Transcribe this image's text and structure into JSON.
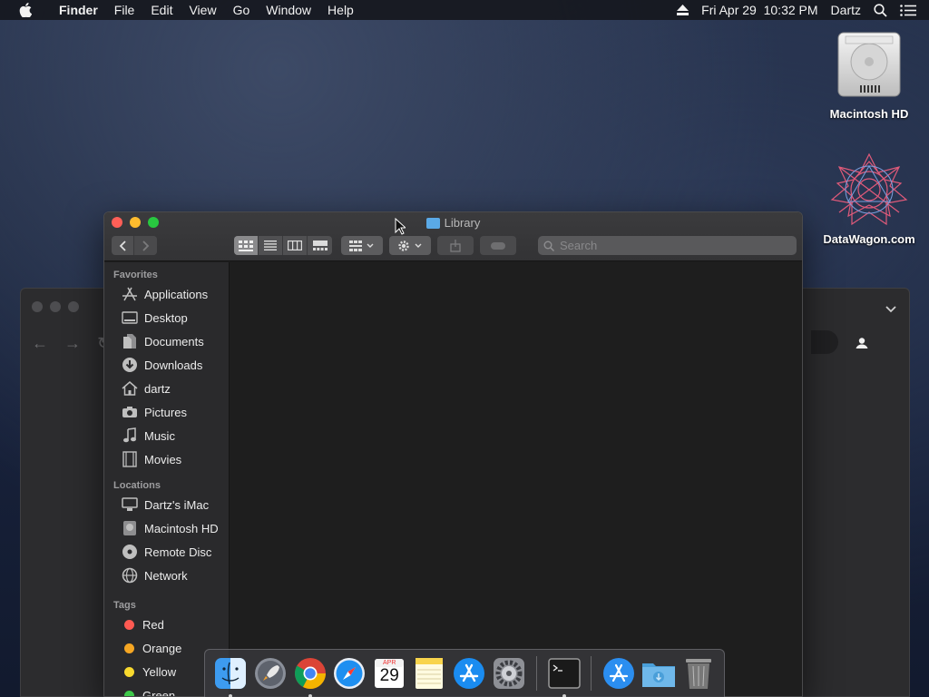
{
  "menubar": {
    "app_name": "Finder",
    "items": [
      "File",
      "Edit",
      "View",
      "Go",
      "Window",
      "Help"
    ],
    "datetime": "Fri Apr 29  10:32 PM",
    "user": "Dartz"
  },
  "desktop_icons": [
    {
      "label": "Macintosh HD",
      "icon": "hard-drive-icon"
    },
    {
      "label": "DataWagon.com",
      "icon": "datawagon-logo-icon"
    }
  ],
  "finder": {
    "title": "Library",
    "search_placeholder": "Search",
    "sidebar": {
      "favorites_title": "Favorites",
      "favorites": [
        {
          "label": "Applications",
          "icon": "applications-icon"
        },
        {
          "label": "Desktop",
          "icon": "desktop-icon"
        },
        {
          "label": "Documents",
          "icon": "documents-icon"
        },
        {
          "label": "Downloads",
          "icon": "downloads-icon"
        },
        {
          "label": "dartz",
          "icon": "home-icon"
        },
        {
          "label": "Pictures",
          "icon": "camera-icon"
        },
        {
          "label": "Music",
          "icon": "music-icon"
        },
        {
          "label": "Movies",
          "icon": "film-icon"
        }
      ],
      "locations_title": "Locations",
      "locations": [
        {
          "label": "Dartz's iMac",
          "icon": "computer-icon"
        },
        {
          "label": "Macintosh HD",
          "icon": "drive-icon"
        },
        {
          "label": "Remote Disc",
          "icon": "disc-icon"
        },
        {
          "label": "Network",
          "icon": "network-icon"
        }
      ],
      "tags_title": "Tags",
      "tags": [
        {
          "label": "Red",
          "color": "#ff5a52"
        },
        {
          "label": "Orange",
          "color": "#f5a623"
        },
        {
          "label": "Yellow",
          "color": "#f8d92e"
        },
        {
          "label": "Green",
          "color": "#3ec94a"
        }
      ]
    }
  },
  "dock": {
    "apps": [
      "Finder",
      "Launchpad",
      "Chrome",
      "Safari",
      "Calendar",
      "Notes",
      "App Store",
      "System Preferences",
      "Terminal",
      "Applications",
      "Downloads",
      "Trash"
    ],
    "calendar_month": "APR",
    "calendar_day": "29"
  },
  "colors": {
    "close": "#ff5f57",
    "minimize": "#febc2e",
    "zoom": "#28c840",
    "folder_blue": "#5aa9e6"
  }
}
